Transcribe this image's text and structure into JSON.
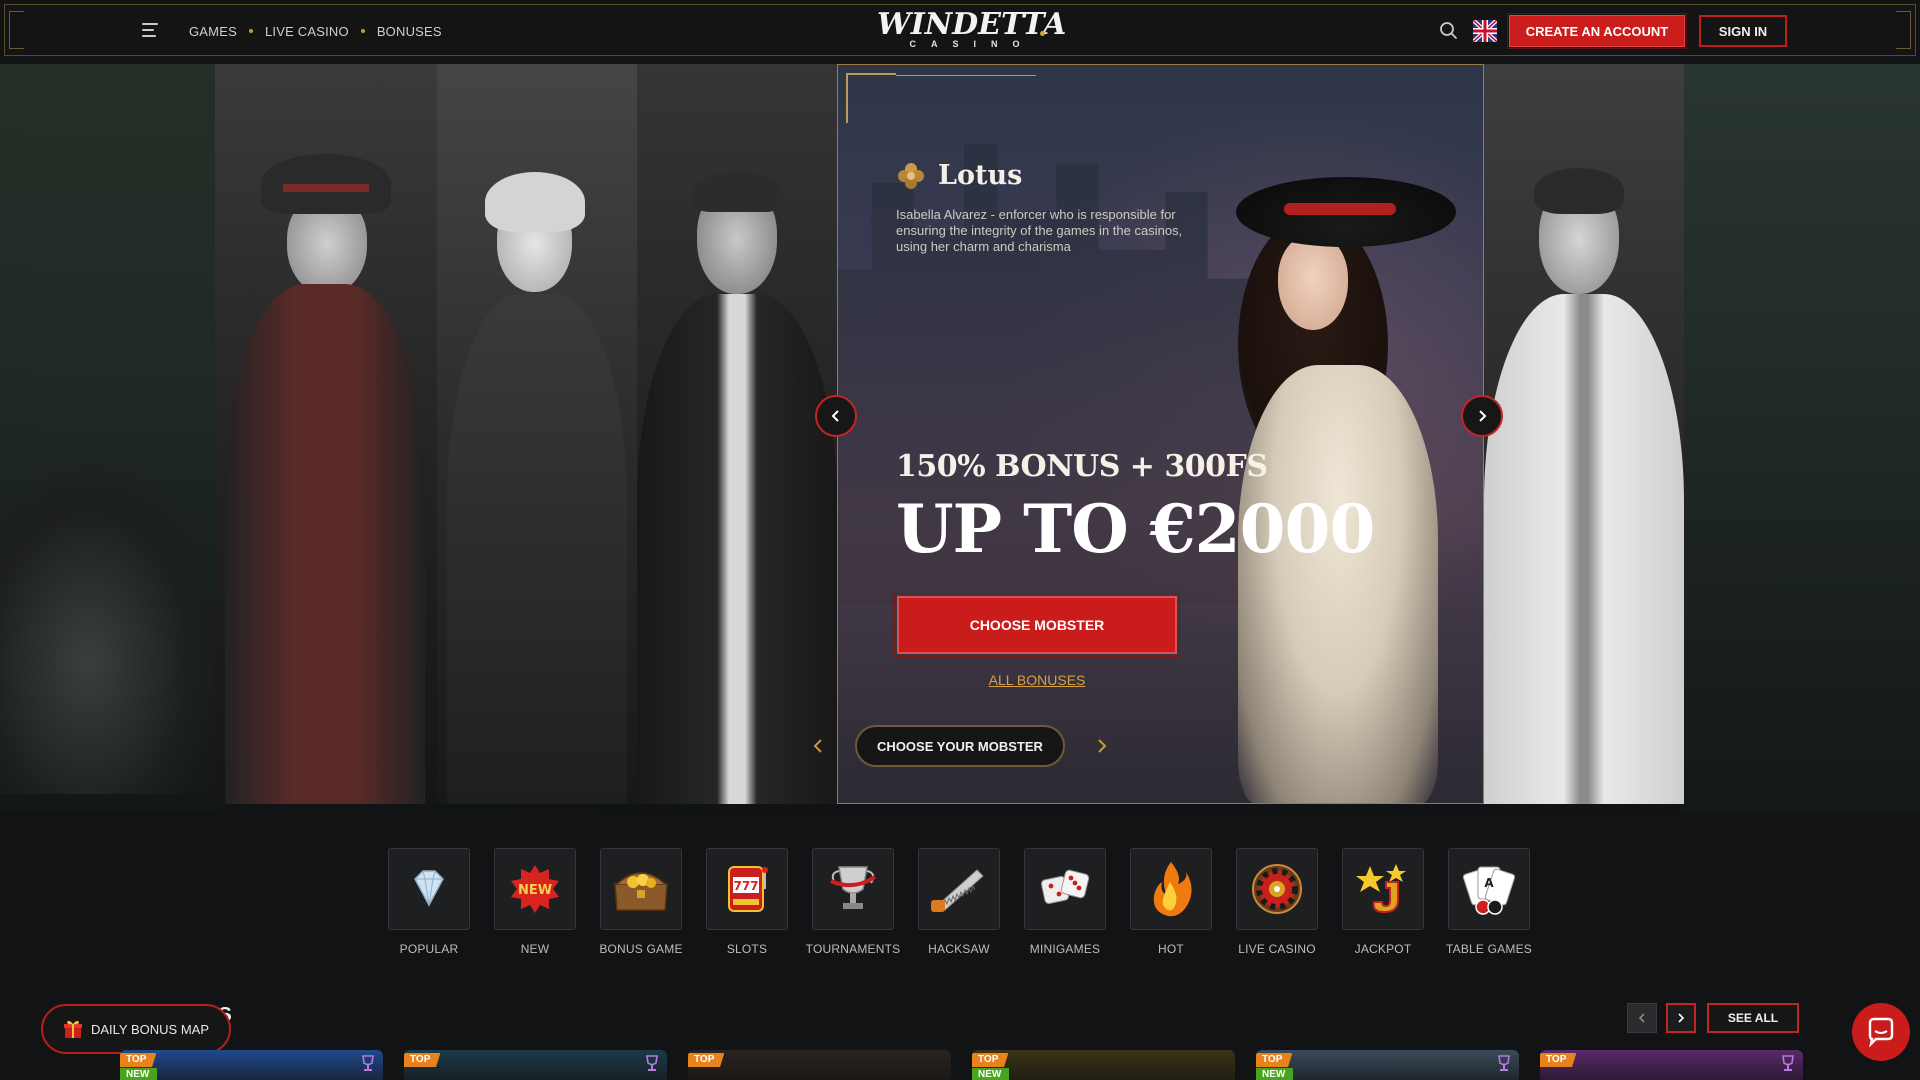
{
  "header": {
    "nav": [
      "GAMES",
      "LIVE CASINO",
      "BONUSES"
    ],
    "logo_main": "WINDETTA",
    "logo_sub": "CASINO",
    "create_account": "CREATE AN ACCOUNT",
    "sign_in": "SIGN IN"
  },
  "hero": {
    "character_name": "Lotus",
    "description": "Isabella Alvarez - enforcer who is responsible for ensuring the integrity of the games in the casinos, using her charm and charisma",
    "bonus_line": "150% BONUS + 300FS",
    "amount_line": "UP TO €2000",
    "cta": "CHOOSE MOBSTER",
    "all_bonuses": "ALL BONUSES",
    "choose_your": "CHOOSE YOUR MOBSTER"
  },
  "categories": [
    {
      "label": "POPULAR",
      "icon": "diamond-icon"
    },
    {
      "label": "NEW",
      "icon": "new-badge-icon"
    },
    {
      "label": "BONUS GAME",
      "icon": "treasure-chest-icon"
    },
    {
      "label": "SLOTS",
      "icon": "slot-machine-icon"
    },
    {
      "label": "TOURNAMENTS",
      "icon": "trophy-icon"
    },
    {
      "label": "HACKSAW",
      "icon": "saw-icon"
    },
    {
      "label": "MINIGAMES",
      "icon": "dice-icon"
    },
    {
      "label": "HOT",
      "icon": "flame-icon"
    },
    {
      "label": "LIVE CASINO",
      "icon": "roulette-icon"
    },
    {
      "label": "JACKPOT",
      "icon": "jackpot-icon"
    },
    {
      "label": "TABLE GAMES",
      "icon": "cards-icon"
    }
  ],
  "games_section": {
    "title_visible": "ES",
    "see_all": "SEE ALL",
    "daily_bonus": "DAILY BONUS MAP",
    "tiles": [
      {
        "top": "TOP",
        "new": "NEW",
        "trophy": true,
        "color": "#1f4a8a"
      },
      {
        "top": "TOP",
        "new": "",
        "trophy": true,
        "color": "#1d3a4a"
      },
      {
        "top": "TOP",
        "new": "",
        "trophy": false,
        "color": "#2a2420"
      },
      {
        "top": "TOP",
        "new": "NEW",
        "trophy": false,
        "color": "#3a3414"
      },
      {
        "top": "TOP",
        "new": "NEW",
        "trophy": true,
        "color": "#3a4a5a"
      },
      {
        "top": "TOP",
        "new": "",
        "trophy": true,
        "color": "#5a2a6a"
      }
    ]
  },
  "colors": {
    "accent_red": "#cb1c1c",
    "gold": "#c49a3a",
    "link_gold": "#d6a147"
  }
}
